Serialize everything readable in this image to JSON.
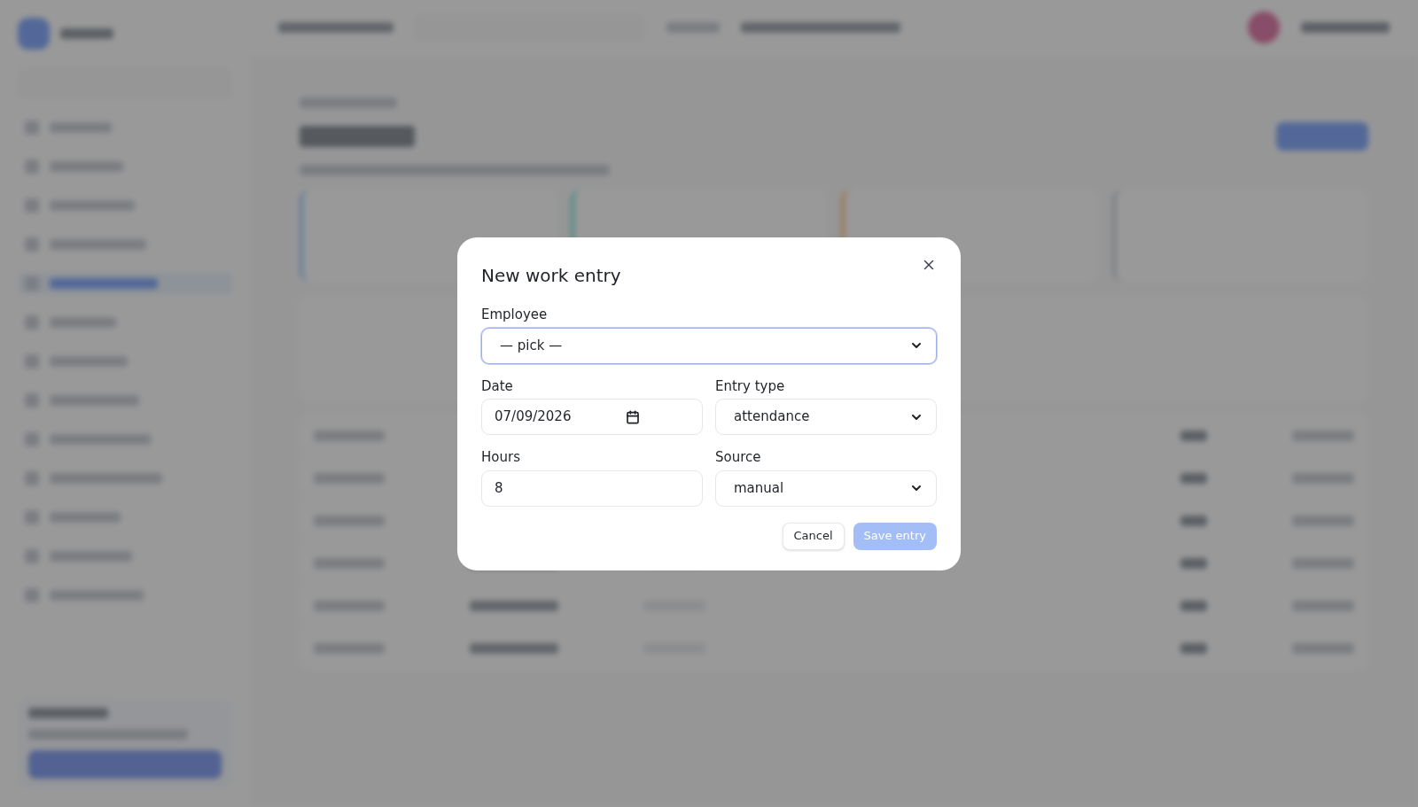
{
  "dialog": {
    "title": "New work entry",
    "fields": [
      {
        "kind": "select",
        "label": "Employee",
        "value": "— pick —",
        "focused": true
      },
      {
        "kind": "date",
        "label": "Date",
        "value": "07/09/2026",
        "focused": false
      },
      {
        "kind": "select",
        "label": "Entry type",
        "value": "attendance",
        "focused": false
      },
      {
        "kind": "text",
        "label": "Hours",
        "value": "8",
        "focused": false
      },
      {
        "kind": "select",
        "label": "Source",
        "value": "manual",
        "focused": false
      }
    ],
    "buttons": [
      {
        "kind": "secondary",
        "label": "Cancel",
        "disabled": false
      },
      {
        "kind": "primary",
        "label": "Save entry",
        "disabled": true
      }
    ]
  }
}
